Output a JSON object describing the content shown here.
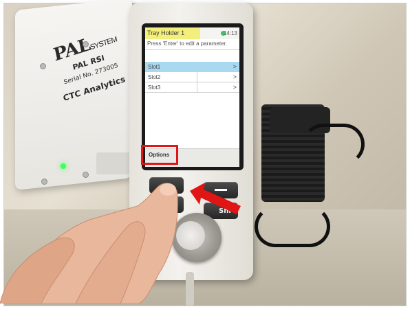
{
  "screen": {
    "title": "Tray Holder 1",
    "time": "14:13",
    "hint": "Press 'Enter' to edit a parameter.",
    "slots": [
      {
        "label": "Slot1",
        "arrow": ">",
        "selected": true
      },
      {
        "label": "Slot2",
        "arrow": ">",
        "selected": false
      },
      {
        "label": "Slot3",
        "arrow": ">",
        "selected": false
      }
    ],
    "options_label": "Options"
  },
  "module": {
    "logo_main": "PAL",
    "logo_sub": "SYSTEM",
    "model": "PAL RSI",
    "serial": "Serial No. 273005",
    "maker": "CTC Analytics"
  },
  "hardware": {
    "right_button_label": "Shi"
  },
  "annotation": {
    "highlight_color": "#e01515",
    "arrow_color": "#e01515"
  }
}
